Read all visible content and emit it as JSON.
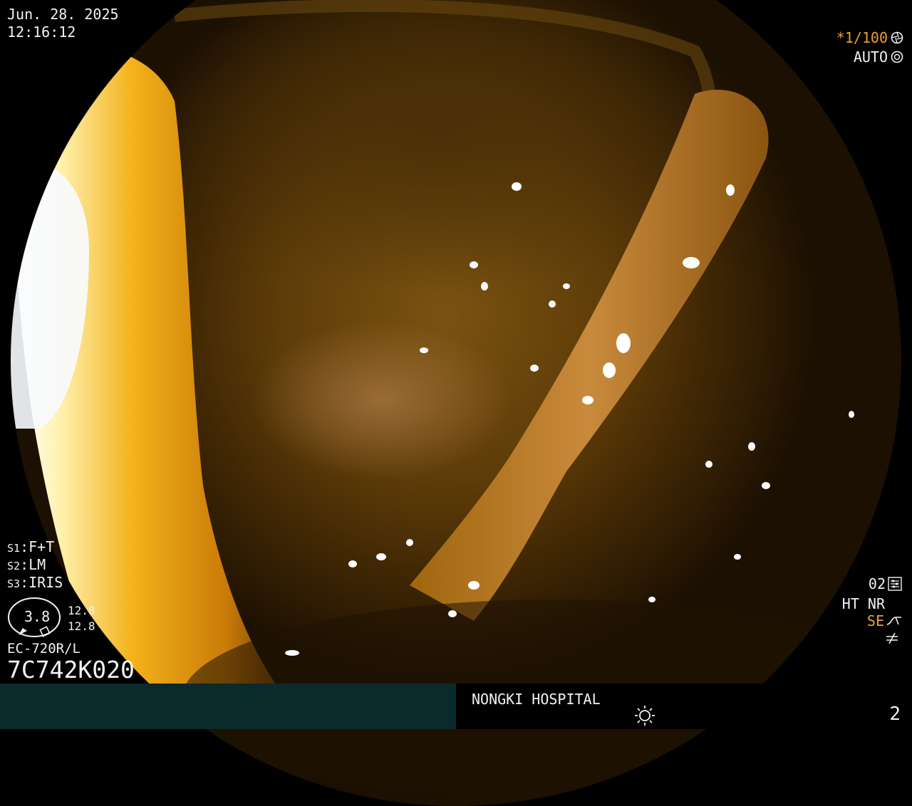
{
  "datetime": {
    "date": "Jun. 28. 2025",
    "time": "12:16:12"
  },
  "shutter": {
    "value": "*1/100",
    "icon": "shutter-icon"
  },
  "exposure": {
    "mode": "AUTO",
    "icon": "iris-icon"
  },
  "switches": [
    {
      "key": "S1",
      "value": "F+T"
    },
    {
      "key": "S2",
      "value": "LM"
    },
    {
      "key": "S3",
      "value": "IRIS"
    }
  ],
  "zoom": {
    "value": "3.8",
    "upper": "12.8",
    "lower": "12.8"
  },
  "scope": {
    "model": "EC-720R/L",
    "serial": "7C742K020"
  },
  "enhancement": {
    "level": "02",
    "level_icon": "settings-sliders-icon",
    "modes": "HT NR",
    "se_label": "SE",
    "se_icon": "signal-curve-icon",
    "extra_icon": "not-equal-icon"
  },
  "footer": {
    "hospital": "NONGKI HOSPITAL",
    "page": "2",
    "light_icon": "light-source-icon"
  },
  "colors": {
    "accent_orange": "#f0a030",
    "footer_left": "#0b2a2c"
  }
}
